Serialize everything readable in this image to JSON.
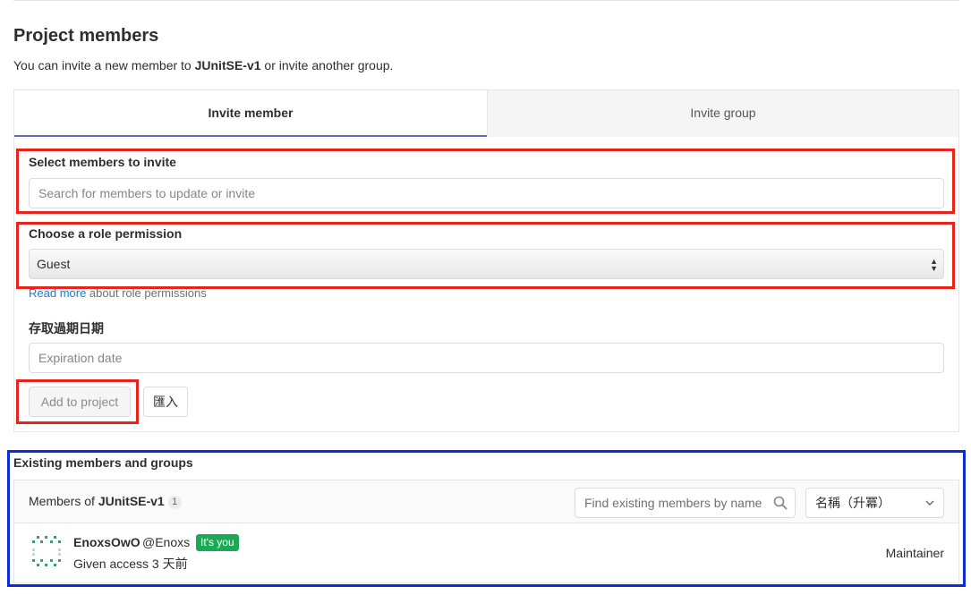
{
  "page": {
    "title": "Project members",
    "intro_prefix": "You can invite a new member to ",
    "project_name": "JUnitSE-v1",
    "intro_suffix": " or invite another group."
  },
  "tabs": {
    "invite_member": "Invite member",
    "invite_group": "Invite group"
  },
  "invite_form": {
    "select_members_label": "Select members to invite",
    "select_members_placeholder": "Search for members to update or invite",
    "role_label": "Choose a role permission",
    "role_value": "Guest",
    "read_more_link": "Read more",
    "read_more_suffix": " about role permissions",
    "expiration_label": "存取過期日期",
    "expiration_placeholder": "Expiration date",
    "add_button": "Add to project",
    "import_button": "匯入"
  },
  "existing": {
    "title": "Existing members and groups",
    "members_of_prefix": "Members of ",
    "project_name": "JUnitSE-v1",
    "count": "1",
    "search_placeholder": "Find existing members by name",
    "sort_value": "名稱（升冪）",
    "members": [
      {
        "name": "EnoxsOwO",
        "username": "@Enoxs",
        "badge": "It's you",
        "access": "Given access 3 天前",
        "role": "Maintainer"
      }
    ]
  },
  "colors": {
    "tab_active_underline": "#6666c4",
    "link": "#1f78d1",
    "badge_green": "#1aaa55",
    "highlight_red": "#e8231b",
    "highlight_blue": "#0a2ddb"
  },
  "icons": [
    "search-icon",
    "chevron-down-icon",
    "select-arrows-icon",
    "avatar-identicon"
  ]
}
